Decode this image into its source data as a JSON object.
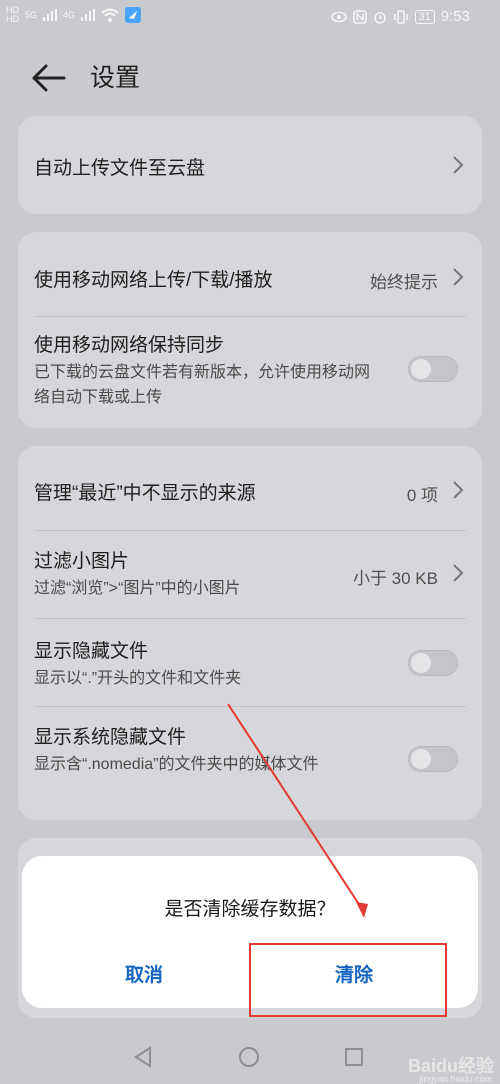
{
  "status_bar": {
    "hd1": "HD",
    "hd2": "HD",
    "net1": "5G",
    "net2": "4G",
    "battery": "31",
    "time": "9:53"
  },
  "header": {
    "title": "设置"
  },
  "settings": {
    "auto_upload": {
      "title": "自动上传文件至云盘"
    },
    "mobile_network": {
      "title": "使用移动网络上传/下载/播放",
      "value": "始终提示"
    },
    "mobile_sync": {
      "title": "使用移动网络保持同步",
      "subtitle": "已下载的云盘文件若有新版本，允许使用移动网络自动下载或上传",
      "enabled": false
    },
    "recent_sources": {
      "title": "管理“最近”中不显示的来源",
      "value": "0 项"
    },
    "filter_images": {
      "title": "过滤小图片",
      "subtitle": "过滤“浏览”>“图片”中的小图片",
      "value": "小于 30 KB"
    },
    "hidden_files": {
      "title": "显示隐藏文件",
      "subtitle": "显示以“.”开头的文件和文件夹",
      "enabled": false
    },
    "system_hidden": {
      "title": "显示系统隐藏文件",
      "subtitle": "显示含“.nomedia”的文件夹中的媒体文件",
      "enabled": false
    }
  },
  "dialog": {
    "message": "是否清除缓存数据？",
    "cancel": "取消",
    "confirm": "清除"
  },
  "watermark": {
    "brand": "Baidu经验",
    "url": "jingyan.baidu.com"
  }
}
